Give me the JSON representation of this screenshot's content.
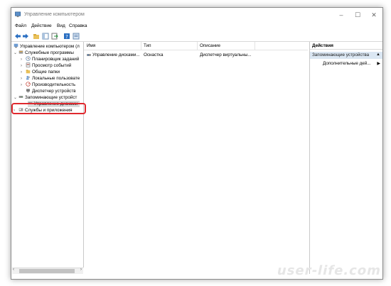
{
  "window": {
    "title": "Управление компьютером"
  },
  "menu": [
    "Файл",
    "Действие",
    "Вид",
    "Справка"
  ],
  "tree": [
    {
      "label": "Управление компьютером (л",
      "level": 0,
      "arrow": ""
    },
    {
      "label": "Служебные программы",
      "level": 1,
      "arrow": "⌄"
    },
    {
      "label": "Планировщик заданий",
      "level": 2,
      "arrow": "›"
    },
    {
      "label": "Просмотр событий",
      "level": 2,
      "arrow": "›"
    },
    {
      "label": "Общие папки",
      "level": 2,
      "arrow": "›"
    },
    {
      "label": "Локальные пользовате",
      "level": 2,
      "arrow": "›"
    },
    {
      "label": "Производительность",
      "level": 2,
      "arrow": "›"
    },
    {
      "label": "Диспетчер устройств",
      "level": 2,
      "arrow": ""
    },
    {
      "label": "Запоминающие устройст",
      "level": 1,
      "arrow": "⌄"
    },
    {
      "label": "Управление дисками",
      "level": 2,
      "arrow": ""
    },
    {
      "label": "Службы и приложения",
      "level": 1,
      "arrow": "›"
    }
  ],
  "list": {
    "columns": [
      "Имя",
      "Тип",
      "Описание"
    ],
    "rows": [
      {
        "name": "Управление дисками...",
        "type": "Оснастка",
        "description": "Диспетчер виртуальны..."
      }
    ]
  },
  "actions": {
    "header": "Действия",
    "section": "Запоминающие устройства",
    "item": "Дополнительные дей..."
  },
  "watermark": "user-life.com"
}
